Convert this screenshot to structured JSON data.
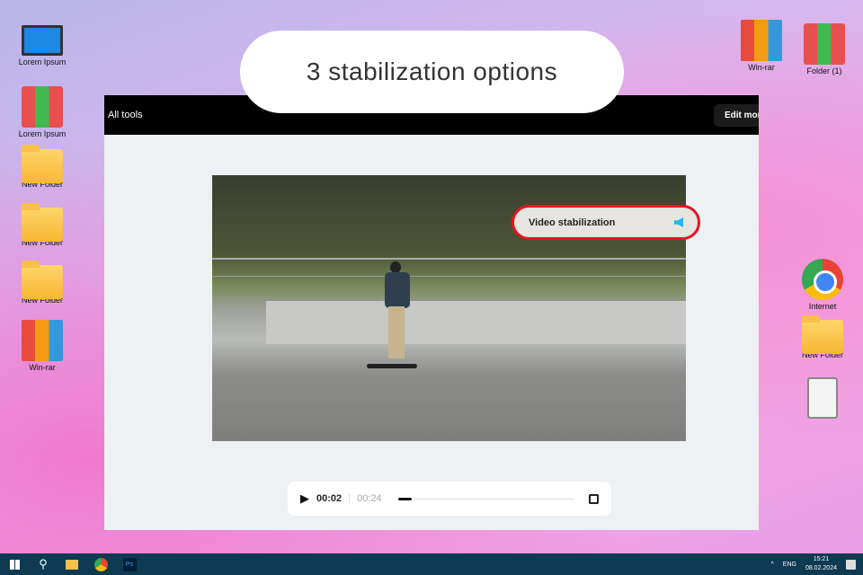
{
  "banner": {
    "title": "3 stabilization options"
  },
  "desktop_left": [
    {
      "label": "Lorem Ipsum",
      "icon": "computer-icon"
    },
    {
      "label": "Lorem Ipsum",
      "icon": "binders-icon"
    },
    {
      "label": "New Folder",
      "icon": "folder-icon"
    },
    {
      "label": "New Folder",
      "icon": "folder-icon"
    },
    {
      "label": "New Folder",
      "icon": "folder-icon"
    },
    {
      "label": "Win-rar",
      "icon": "winrar-icon"
    }
  ],
  "desktop_right": [
    {
      "label": "Win-rar",
      "icon": "winrar-icon"
    },
    {
      "label": "Folder (1)",
      "icon": "binders-icon"
    },
    {
      "label": "Internet",
      "icon": "chrome-icon"
    },
    {
      "label": "New Folder",
      "icon": "folder-icon"
    },
    {
      "label": "",
      "icon": "recycle-bin-icon"
    }
  ],
  "app": {
    "all_tools": "All tools",
    "edit_more": "Edit more"
  },
  "overlay": {
    "label": "Video stabilization",
    "accent": "#e8141e"
  },
  "player": {
    "current_time": "00:02",
    "duration": "00:24",
    "progress": 0.08
  },
  "taskbar": {
    "lang": "ENG",
    "time": "15:21",
    "date": "08.02.2024",
    "tray_arrow": "^"
  }
}
